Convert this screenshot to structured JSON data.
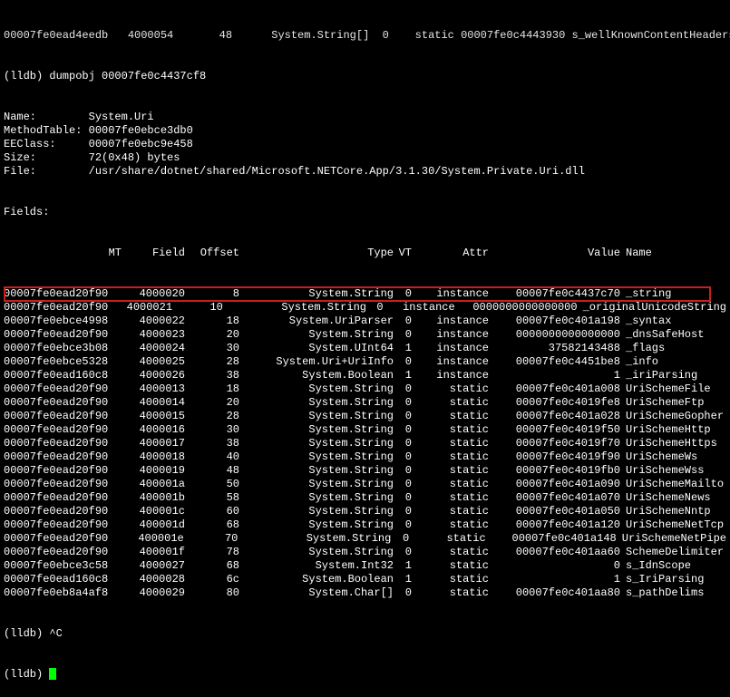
{
  "top_line": "00007fe0ead4eedb   4000054       48      System.String[]  0    static 00007fe0c4443930 s_wellKnownContentHeaders",
  "prompt_line": "(lldb) dumpobj 00007fe0c4437cf8",
  "header": {
    "items": [
      [
        "Name:",
        "System.Uri"
      ],
      [
        "MethodTable:",
        "00007fe0ebce3db0"
      ],
      [
        "EEClass:",
        "00007fe0ebc9e458"
      ],
      [
        "Size:",
        "72(0x48) bytes"
      ],
      [
        "File:",
        "/usr/share/dotnet/shared/Microsoft.NETCore.App/3.1.30/System.Private.Uri.dll"
      ]
    ],
    "fields_label": "Fields:"
  },
  "columns": {
    "mt": "MT",
    "field": "Field",
    "offset": "Offset",
    "type": "Type",
    "vt": "VT",
    "attr": "Attr",
    "value": "Value",
    "name": "Name"
  },
  "rows": [
    {
      "mt": "00007fe0ead20f90",
      "field": "4000020",
      "offset": "8",
      "type": "System.String",
      "vt": "0",
      "attr": "instance",
      "value": "00007fe0c4437c70",
      "name": "_string",
      "hl": true
    },
    {
      "mt": "00007fe0ead20f90",
      "field": "4000021",
      "offset": "10",
      "type": "System.String",
      "vt": "0",
      "attr": "instance",
      "value": "0000000000000000",
      "name": "_originalUnicodeString"
    },
    {
      "mt": "00007fe0ebce4998",
      "field": "4000022",
      "offset": "18",
      "type": "System.UriParser",
      "vt": "0",
      "attr": "instance",
      "value": "00007fe0c401a198",
      "name": "_syntax"
    },
    {
      "mt": "00007fe0ead20f90",
      "field": "4000023",
      "offset": "20",
      "type": "System.String",
      "vt": "0",
      "attr": "instance",
      "value": "0000000000000000",
      "name": "_dnsSafeHost"
    },
    {
      "mt": "00007fe0ebce3b08",
      "field": "4000024",
      "offset": "30",
      "type": "System.UInt64",
      "vt": "1",
      "attr": "instance",
      "value": "37582143488",
      "name": "_flags"
    },
    {
      "mt": "00007fe0ebce5328",
      "field": "4000025",
      "offset": "28",
      "type": "System.Uri+UriInfo",
      "vt": "0",
      "attr": "instance",
      "value": "00007fe0c4451be8",
      "name": "_info"
    },
    {
      "mt": "00007fe0ead160c8",
      "field": "4000026",
      "offset": "38",
      "type": "System.Boolean",
      "vt": "1",
      "attr": "instance",
      "value": "1",
      "name": "_iriParsing"
    },
    {
      "mt": "00007fe0ead20f90",
      "field": "4000013",
      "offset": "18",
      "type": "System.String",
      "vt": "0",
      "attr": "static",
      "value": "00007fe0c401a008",
      "name": "UriSchemeFile"
    },
    {
      "mt": "00007fe0ead20f90",
      "field": "4000014",
      "offset": "20",
      "type": "System.String",
      "vt": "0",
      "attr": "static",
      "value": "00007fe0c4019fe8",
      "name": "UriSchemeFtp"
    },
    {
      "mt": "00007fe0ead20f90",
      "field": "4000015",
      "offset": "28",
      "type": "System.String",
      "vt": "0",
      "attr": "static",
      "value": "00007fe0c401a028",
      "name": "UriSchemeGopher"
    },
    {
      "mt": "00007fe0ead20f90",
      "field": "4000016",
      "offset": "30",
      "type": "System.String",
      "vt": "0",
      "attr": "static",
      "value": "00007fe0c4019f50",
      "name": "UriSchemeHttp"
    },
    {
      "mt": "00007fe0ead20f90",
      "field": "4000017",
      "offset": "38",
      "type": "System.String",
      "vt": "0",
      "attr": "static",
      "value": "00007fe0c4019f70",
      "name": "UriSchemeHttps"
    },
    {
      "mt": "00007fe0ead20f90",
      "field": "4000018",
      "offset": "40",
      "type": "System.String",
      "vt": "0",
      "attr": "static",
      "value": "00007fe0c4019f90",
      "name": "UriSchemeWs"
    },
    {
      "mt": "00007fe0ead20f90",
      "field": "4000019",
      "offset": "48",
      "type": "System.String",
      "vt": "0",
      "attr": "static",
      "value": "00007fe0c4019fb0",
      "name": "UriSchemeWss"
    },
    {
      "mt": "00007fe0ead20f90",
      "field": "400001a",
      "offset": "50",
      "type": "System.String",
      "vt": "0",
      "attr": "static",
      "value": "00007fe0c401a090",
      "name": "UriSchemeMailto"
    },
    {
      "mt": "00007fe0ead20f90",
      "field": "400001b",
      "offset": "58",
      "type": "System.String",
      "vt": "0",
      "attr": "static",
      "value": "00007fe0c401a070",
      "name": "UriSchemeNews"
    },
    {
      "mt": "00007fe0ead20f90",
      "field": "400001c",
      "offset": "60",
      "type": "System.String",
      "vt": "0",
      "attr": "static",
      "value": "00007fe0c401a050",
      "name": "UriSchemeNntp"
    },
    {
      "mt": "00007fe0ead20f90",
      "field": "400001d",
      "offset": "68",
      "type": "System.String",
      "vt": "0",
      "attr": "static",
      "value": "00007fe0c401a120",
      "name": "UriSchemeNetTcp"
    },
    {
      "mt": "00007fe0ead20f90",
      "field": "400001e",
      "offset": "70",
      "type": "System.String",
      "vt": "0",
      "attr": "static",
      "value": "00007fe0c401a148",
      "name": "UriSchemeNetPipe"
    },
    {
      "mt": "00007fe0ead20f90",
      "field": "400001f",
      "offset": "78",
      "type": "System.String",
      "vt": "0",
      "attr": "static",
      "value": "00007fe0c401aa60",
      "name": "SchemeDelimiter"
    },
    {
      "mt": "00007fe0ebce3c58",
      "field": "4000027",
      "offset": "68",
      "type": "System.Int32",
      "vt": "1",
      "attr": "static",
      "value": "0",
      "name": "s_IdnScope"
    },
    {
      "mt": "00007fe0ead160c8",
      "field": "4000028",
      "offset": "6c",
      "type": "System.Boolean",
      "vt": "1",
      "attr": "static",
      "value": "1",
      "name": "s_IriParsing"
    },
    {
      "mt": "00007fe0eb8a4af8",
      "field": "4000029",
      "offset": "80",
      "type": "System.Char[]",
      "vt": "0",
      "attr": "static",
      "value": "00007fe0c401aa80",
      "name": "s_pathDelims"
    }
  ],
  "footer": {
    "interrupt": "(lldb) ^C",
    "prompt": "(lldb) "
  }
}
